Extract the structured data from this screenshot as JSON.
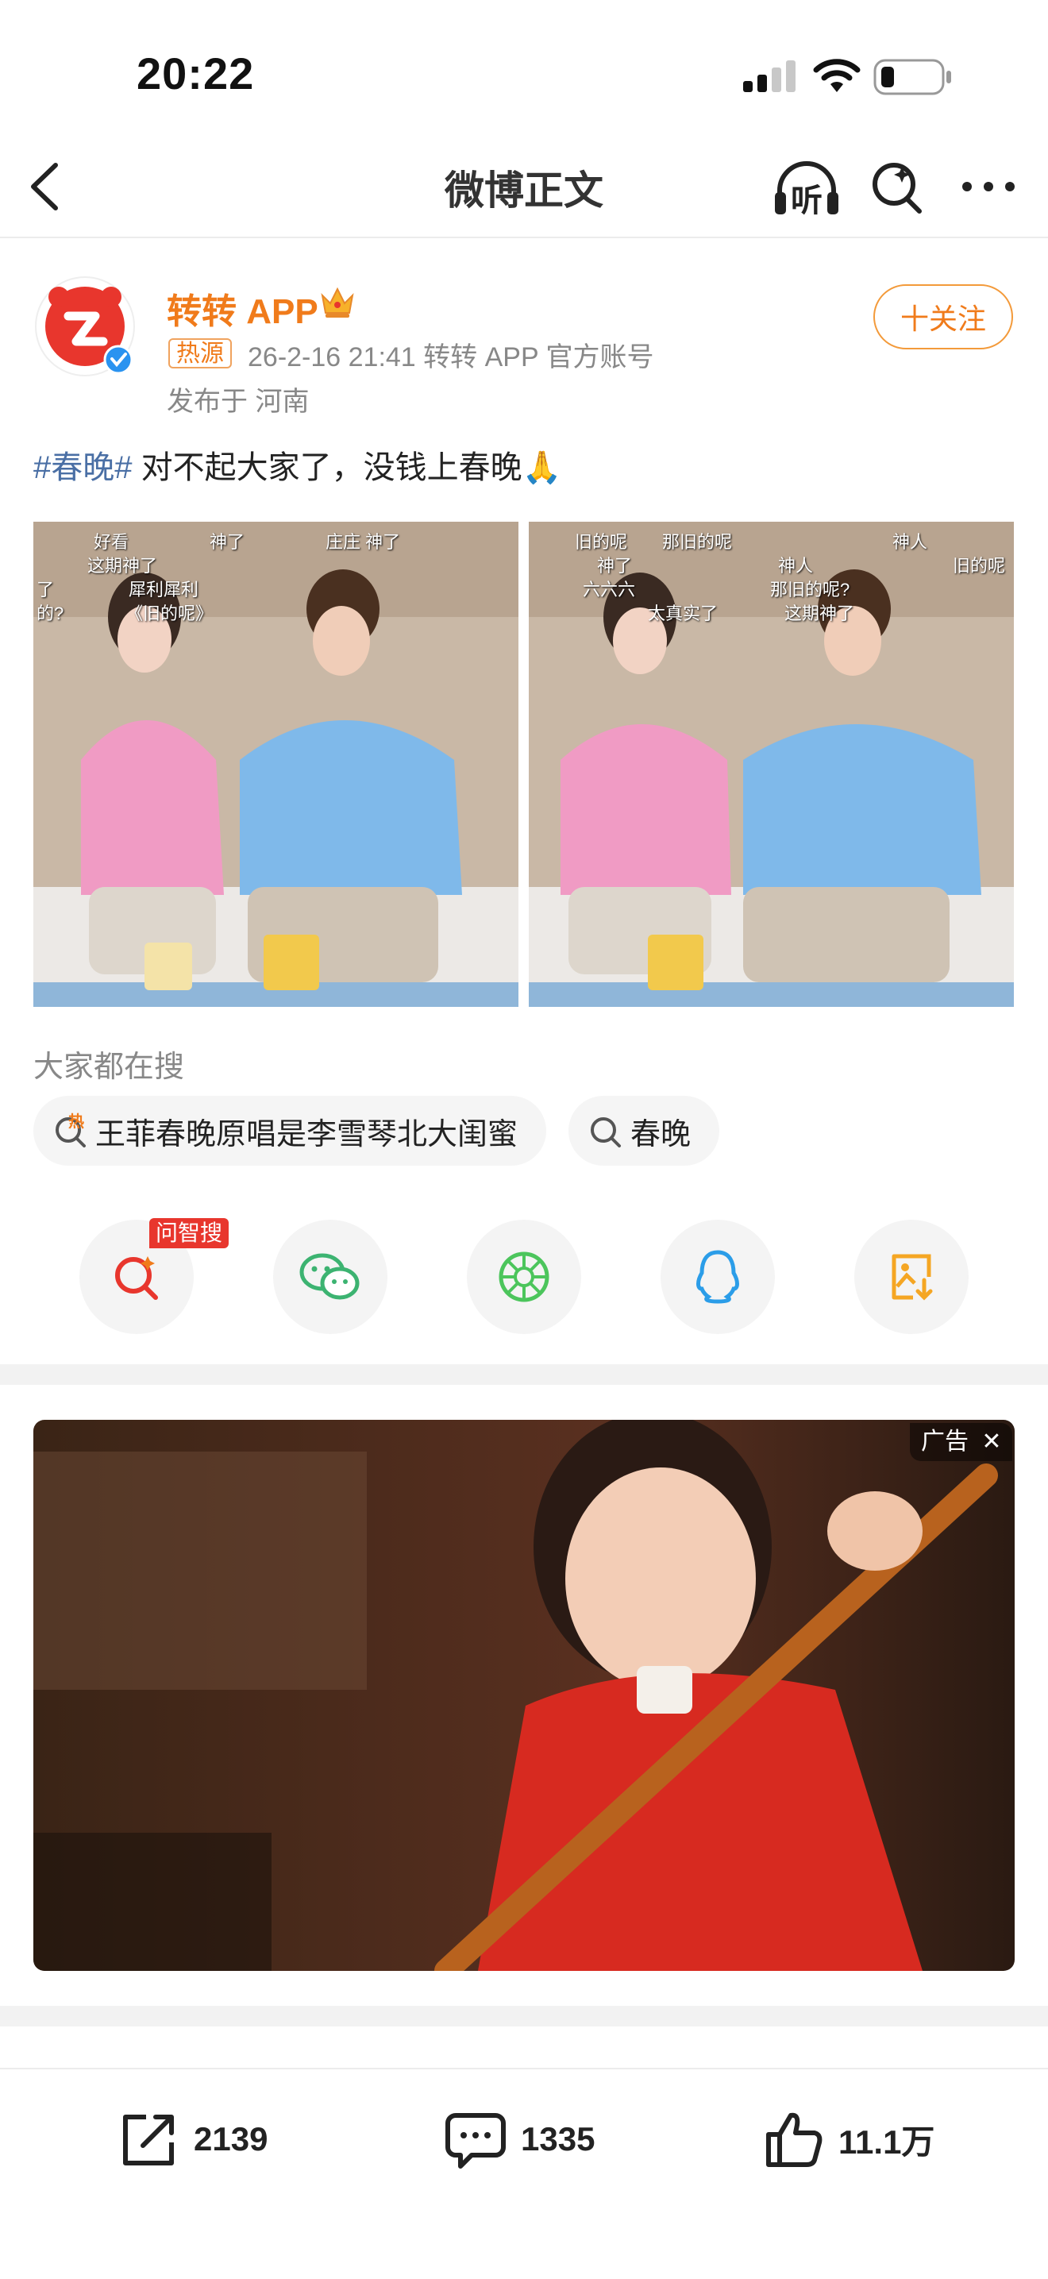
{
  "status_bar": {
    "time": "20:22"
  },
  "nav": {
    "title": "微博正文",
    "listen_label": "听"
  },
  "post": {
    "author": "转转 APP",
    "hot_badge": "热源",
    "meta": "26-2-16 21:41  转转 APP 官方账号",
    "location": "发布于 河南",
    "follow_label": "十关注",
    "hashtag": "#春晚#",
    "text": " 对不起大家了，没钱上春晚🙏",
    "images": [
      {
        "captions": [
          "好看",
          "神了",
          "庄庄 神了",
          "这期神了",
          "犀利犀利",
          "《旧的呢》",
          "了",
          "的?"
        ]
      },
      {
        "captions": [
          "旧的呢",
          "那旧的呢",
          "神人",
          "神了",
          "神人",
          "旧的呢",
          "六六六",
          "那旧的呢?",
          "太真实了",
          "这期神了"
        ]
      }
    ]
  },
  "search": {
    "label": "大家都在搜",
    "chips": [
      {
        "hot_mark": "热",
        "text": "王菲春晚原唱是李雪琴北大闺蜜"
      },
      {
        "text": "春晚"
      }
    ]
  },
  "share": {
    "ai_badge": "问智搜",
    "items": [
      "ai-search-icon",
      "wechat-icon",
      "moments-icon",
      "qq-icon",
      "save-image-icon"
    ]
  },
  "ad": {
    "tag": "广告"
  },
  "actions": {
    "reposts": "2139",
    "comments": "1335",
    "likes": "11.1万"
  },
  "colors": {
    "accent": "#f07b1b",
    "hashtag": "#4a6fa5",
    "badge": "#e8362d"
  }
}
